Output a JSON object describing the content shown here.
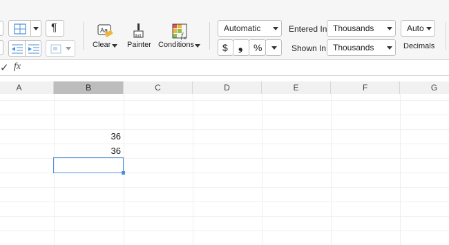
{
  "toolbar": {
    "clear_label": "Clear",
    "painter_label": "Painter",
    "conditions_label": "Conditions",
    "number_format": "Automatic",
    "entered_in_label": "Entered In",
    "entered_in_value": "Thousands",
    "shown_in_label": "Shown In",
    "shown_in_value": "Thousands",
    "decimals_value": "Auto",
    "decimals_label": "Decimals",
    "currency_symbol": "$",
    "comma_symbol": "❟",
    "percent_symbol": "%",
    "pilcrow_symbol": "¶"
  },
  "formula_bar": {
    "check_icon": "✓",
    "fx_label": "fx",
    "content": ""
  },
  "columns": [
    "A",
    "B",
    "C",
    "D",
    "E",
    "F",
    "G"
  ],
  "selected_column": "B",
  "cells": {
    "b1": "36",
    "b2": "36"
  },
  "colors": {
    "selection_border": "#4a90d9",
    "selected_header": "#bdbdbd"
  }
}
